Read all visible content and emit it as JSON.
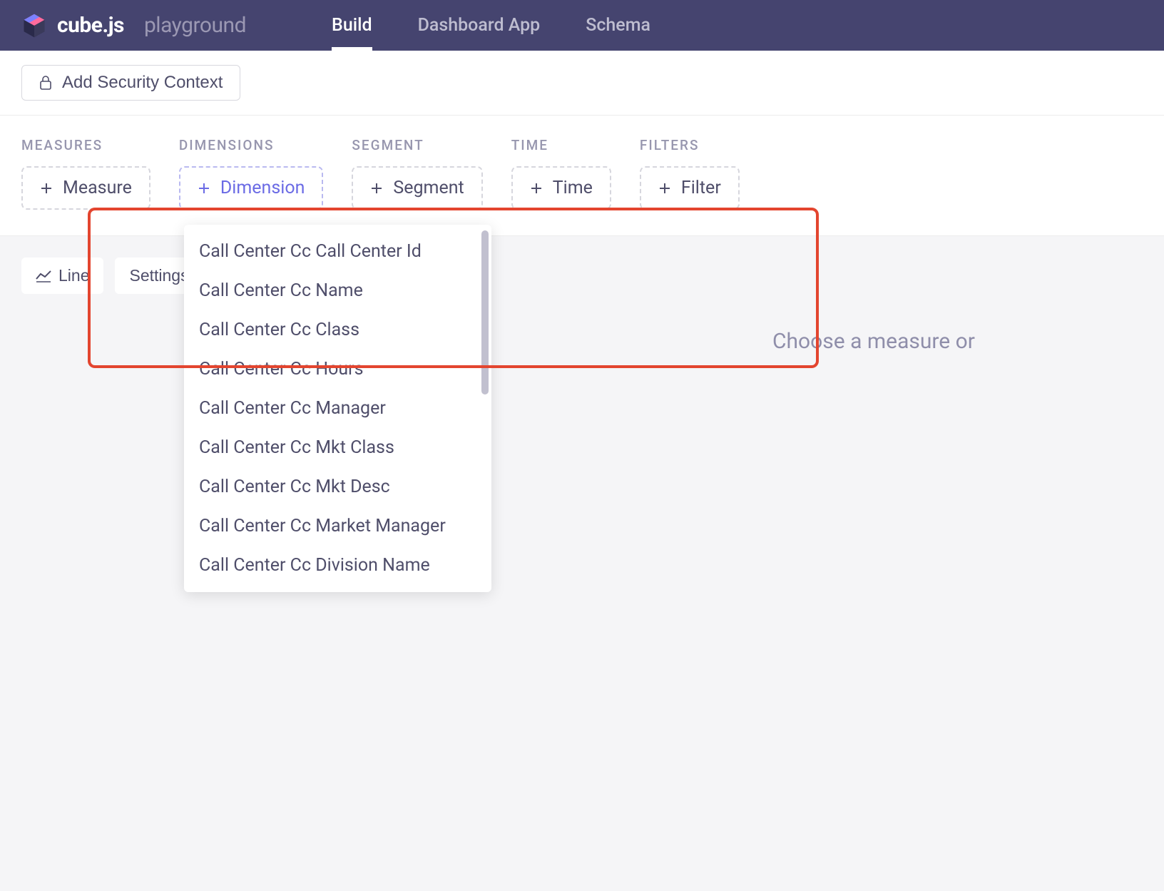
{
  "header": {
    "brand": "cube.js",
    "sub": "playground",
    "nav": [
      {
        "label": "Build",
        "active": true
      },
      {
        "label": "Dashboard App",
        "active": false
      },
      {
        "label": "Schema",
        "active": false
      }
    ]
  },
  "toolbar": {
    "security_context_label": "Add Security Context"
  },
  "builder": {
    "groups": [
      {
        "label": "MEASURES",
        "chip": "Measure",
        "active": false
      },
      {
        "label": "DIMENSIONS",
        "chip": "Dimension",
        "active": true
      },
      {
        "label": "SEGMENT",
        "chip": "Segment",
        "active": false
      },
      {
        "label": "TIME",
        "chip": "Time",
        "active": false
      },
      {
        "label": "FILTERS",
        "chip": "Filter",
        "active": false
      }
    ]
  },
  "chart": {
    "type_label": "Line",
    "settings_label": "Settings",
    "empty_message": "Choose a measure or"
  },
  "dimension_dropdown": {
    "items": [
      "Call Center Cc Call Center Id",
      "Call Center Cc Name",
      "Call Center Cc Class",
      "Call Center Cc Hours",
      "Call Center Cc Manager",
      "Call Center Cc Mkt Class",
      "Call Center Cc Mkt Desc",
      "Call Center Cc Market Manager",
      "Call Center Cc Division Name"
    ]
  }
}
